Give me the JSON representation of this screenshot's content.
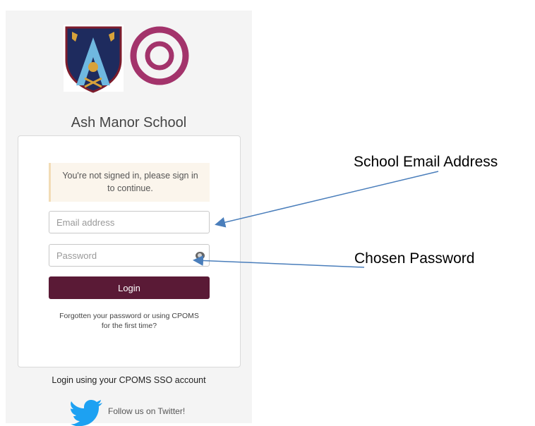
{
  "school_name": "Ash Manor School",
  "alert": {
    "message": "You're not signed in, please sign in to continue."
  },
  "email_input": {
    "placeholder": "Email address",
    "value": ""
  },
  "password_input": {
    "placeholder": "Password",
    "value": ""
  },
  "login_button": {
    "label": "Login"
  },
  "forgot_link": {
    "label": "Forgotten your password or using CPOMS for the first time?"
  },
  "sso_link": {
    "label": "Login using your CPOMS SSO account"
  },
  "twitter": {
    "label": "Follow us on Twitter!",
    "icon": "twitter-bird-icon"
  },
  "annotations": {
    "email": "School Email Address",
    "password": "Chosen Password"
  },
  "colors": {
    "login_button": "#5a1a36",
    "cpoms_logo": "#a3336b",
    "annotation_arrow": "#4a7ebb",
    "twitter": "#1da1f2"
  }
}
